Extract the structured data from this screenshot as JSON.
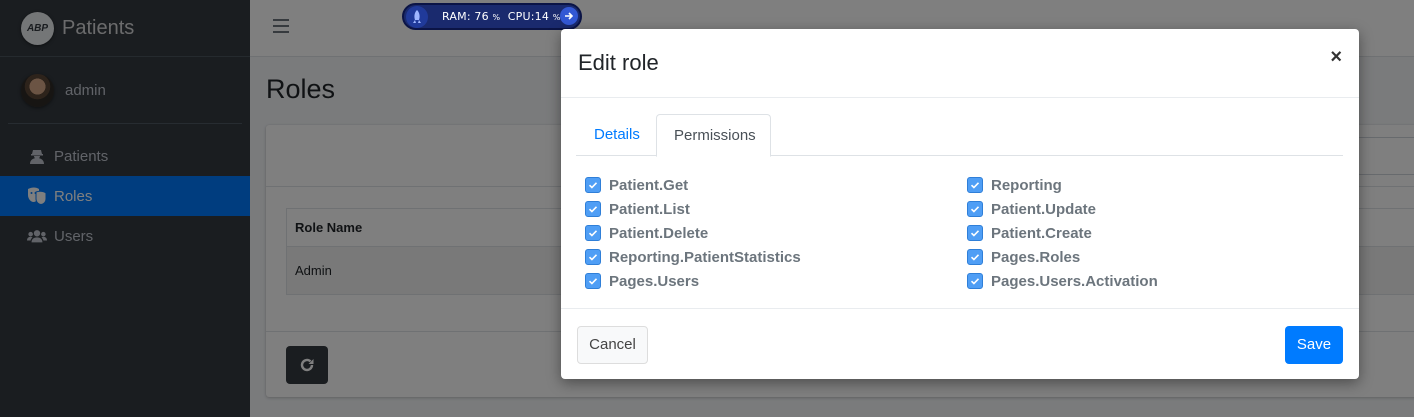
{
  "brand": {
    "logo_text": "ABP",
    "title": "Patients"
  },
  "user": {
    "name": "admin"
  },
  "sidebar": {
    "items": [
      {
        "label": "Patients",
        "icon": "user-secret-icon",
        "active": false
      },
      {
        "label": "Roles",
        "icon": "theater-masks-icon",
        "active": true
      },
      {
        "label": "Users",
        "icon": "users-icon",
        "active": false
      }
    ]
  },
  "page": {
    "title": "Roles"
  },
  "table": {
    "headers": [
      "Role Name"
    ],
    "rows": [
      [
        "Admin"
      ]
    ]
  },
  "monitor": {
    "ram_label": "RAM: 76",
    "cpu_label": "CPU:14",
    "unit": "%"
  },
  "modal": {
    "title": "Edit role",
    "close": "×",
    "tabs": [
      {
        "label": "Details",
        "active": false
      },
      {
        "label": "Permissions",
        "active": true
      }
    ],
    "permissions": [
      {
        "label": "Patient.Get",
        "checked": true
      },
      {
        "label": "Reporting",
        "checked": true
      },
      {
        "label": "Patient.List",
        "checked": true
      },
      {
        "label": "Patient.Update",
        "checked": true
      },
      {
        "label": "Patient.Delete",
        "checked": true
      },
      {
        "label": "Patient.Create",
        "checked": true
      },
      {
        "label": "Reporting.PatientStatistics",
        "checked": true
      },
      {
        "label": "Pages.Roles",
        "checked": true
      },
      {
        "label": "Pages.Users",
        "checked": true
      },
      {
        "label": "Pages.Users.Activation",
        "checked": true
      }
    ],
    "cancel_label": "Cancel",
    "save_label": "Save"
  },
  "colors": {
    "sidebar_bg": "#343a40",
    "primary": "#007bff",
    "checkbox": "#4f9ef5"
  }
}
